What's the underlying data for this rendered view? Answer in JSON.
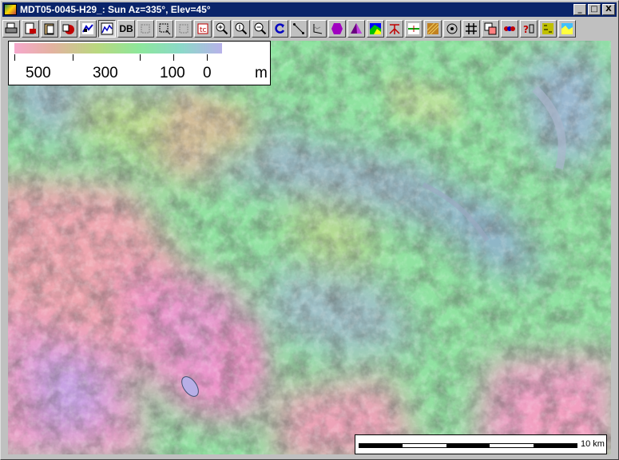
{
  "window": {
    "title": "MDT05-0045-H29_: Sun Az=335°, Elev=45°",
    "controls": {
      "minimize": "_",
      "maximize": "□",
      "close": "X"
    }
  },
  "toolbar": {
    "db_label": "DB",
    "tools": [
      "print-icon",
      "print-preview-icon",
      "clipboard-icon",
      "save-icon",
      "layers-icon",
      "map-graph-icon",
      "db-button",
      "zoom-box-icon",
      "select-icon",
      "pan-icon",
      "text-icon",
      "zoom-in-icon",
      "zoom-full-icon",
      "zoom-out-icon",
      "redraw-icon",
      "distance-icon",
      "profile-icon",
      "volume-icon",
      "perspective-icon",
      "color-map-icon",
      "tree-icon",
      "cross-section-icon",
      "texture-icon",
      "circle-target-icon",
      "grid-icon",
      "overlay-icon",
      "color-bar-icon",
      "info-icon",
      "gps-icon",
      "aspect-icon"
    ]
  },
  "legend": {
    "labels": [
      "500",
      "300",
      "100",
      "0"
    ],
    "unit": "m",
    "colors": [
      "#f6a8cc",
      "#e3b2a0",
      "#b9d87f",
      "#8de79b",
      "#8bd9c8",
      "#b8b2ea"
    ]
  },
  "scalebar": {
    "label": "10 km"
  }
}
